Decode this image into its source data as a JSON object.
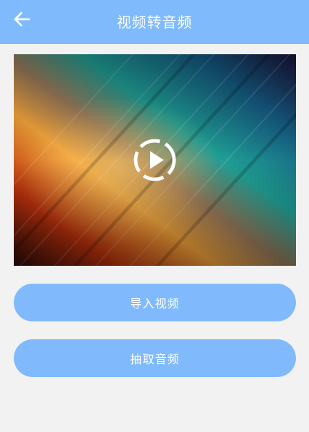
{
  "header": {
    "title": "视频转音频",
    "back_icon": "arrow-left-icon"
  },
  "video": {
    "play_icon": "play-circle-icon"
  },
  "actions": {
    "import_label": "导入视频",
    "extract_label": "抽取音频"
  },
  "colors": {
    "accent": "#7fbafc",
    "background": "#f2f2f2",
    "text_on_accent": "#ffffff"
  }
}
